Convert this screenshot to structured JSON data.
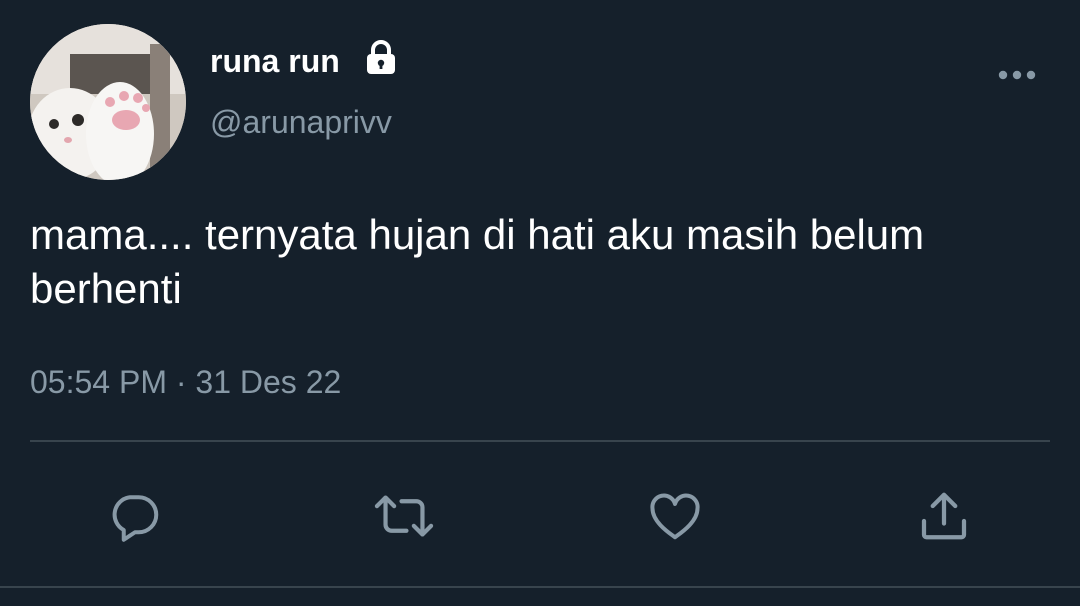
{
  "tweet": {
    "author": {
      "display_name": "runa run",
      "handle": "@arunaprivv",
      "protected_icon": "lock-icon",
      "avatar_icon": "cat-paw-avatar"
    },
    "text": "mama.... ternyata hujan di hati aku masih belum berhenti",
    "timestamp": "05:54 PM · 31 Des 22",
    "menu_icon": "more-horizontal-icon"
  },
  "actions": [
    {
      "icon": "reply-icon"
    },
    {
      "icon": "retweet-icon"
    },
    {
      "icon": "like-icon"
    },
    {
      "icon": "share-icon"
    }
  ],
  "colors": {
    "background": "#15202b",
    "primary_text": "#ffffff",
    "secondary_text": "#8899a6",
    "divider": "#38444d"
  }
}
